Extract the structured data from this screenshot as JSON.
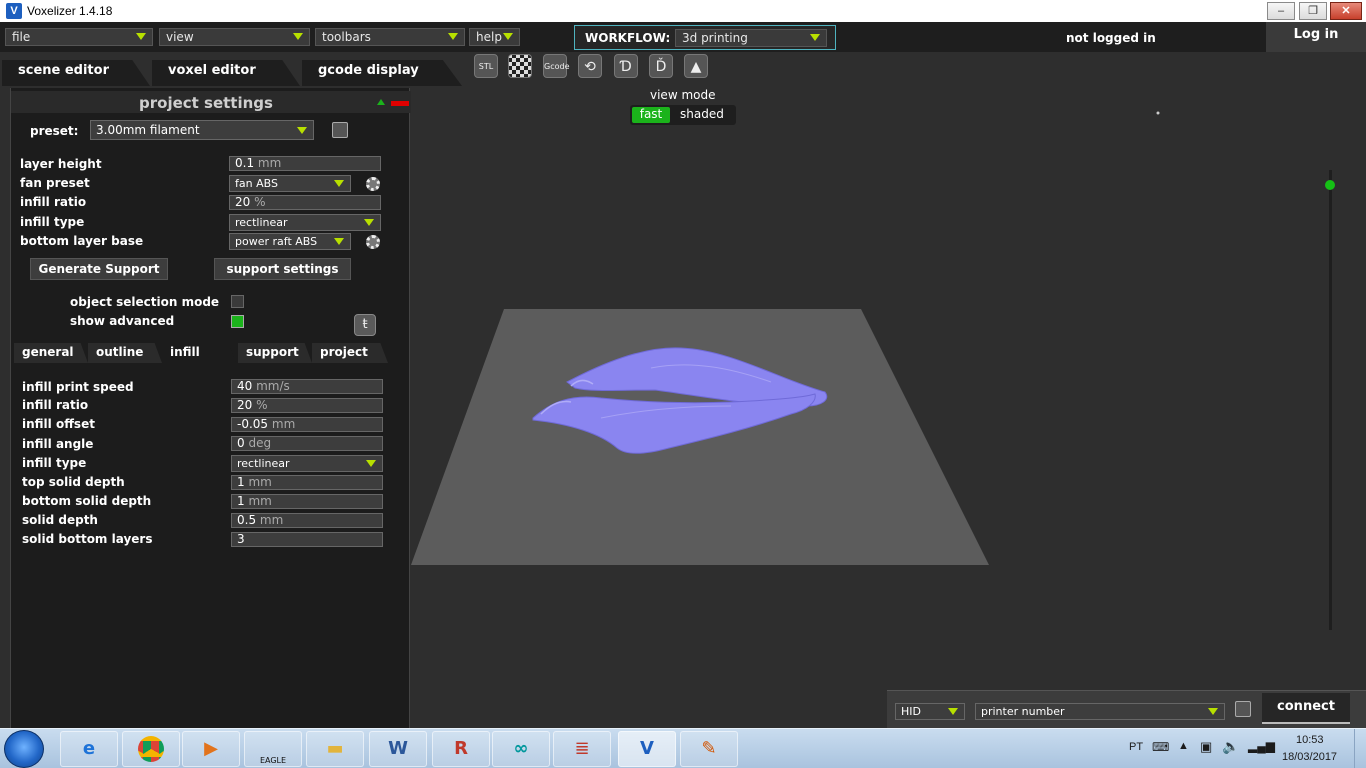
{
  "window": {
    "title": "Voxelizer 1.4.18"
  },
  "menubar": {
    "file": "file",
    "view": "view",
    "toolbars": "toolbars",
    "help": "help",
    "workflow_label": "WORKFLOW:",
    "workflow_value": "3d printing",
    "login_status": "not logged in",
    "login_button": "Log in"
  },
  "tabs": {
    "scene_editor": "scene editor",
    "voxel_editor": "voxel editor",
    "gcode_display": "gcode display"
  },
  "toolbar_icons": {
    "stl": "STL",
    "gcode": "Gcode"
  },
  "panel": {
    "title": "project settings",
    "preset_label": "preset:",
    "preset_value": "3.00mm filament",
    "layer_height_label": "layer height",
    "layer_height_value": "0.1",
    "layer_height_unit": "mm",
    "fan_preset_label": "fan preset",
    "fan_preset_value": "fan ABS",
    "infill_ratio_label": "infill ratio",
    "infill_ratio_value": "20",
    "infill_ratio_unit": "%",
    "infill_type_label": "infill type",
    "infill_type_value": "rectlinear",
    "bottom_layer_base_label": "bottom layer base",
    "bottom_layer_base_value": "power raft ABS",
    "generate_support": "Generate Support",
    "support_settings": "support settings",
    "object_selection_mode": "object selection mode",
    "show_advanced": "show advanced",
    "subtabs": {
      "general": "general",
      "outline": "outline",
      "infill": "infill",
      "support": "support",
      "project": "project"
    },
    "adv": {
      "speed_label": "infill print speed",
      "speed_value": "40",
      "speed_unit": "mm/s",
      "ratio_label": "infill ratio",
      "ratio_value": "20",
      "ratio_unit": "%",
      "offset_label": "infill offset",
      "offset_value": "-0.05",
      "offset_unit": "mm",
      "angle_label": "infill angle",
      "angle_value": "0",
      "angle_unit": "deg",
      "type_label": "infill type",
      "type_value": "rectlinear",
      "top_label": "top solid depth",
      "top_value": "1",
      "top_unit": "mm",
      "bottom_label": "bottom solid depth",
      "bottom_value": "1",
      "bottom_unit": "mm",
      "solid_label": "solid depth",
      "solid_value": "0.5",
      "solid_unit": "mm",
      "layers_label": "solid bottom layers",
      "layers_value": "3"
    }
  },
  "viewport": {
    "view_mode_label": "view mode",
    "fast": "fast",
    "shaded": "shaded"
  },
  "connection": {
    "port": "HID",
    "printer": "printer number",
    "connect": "connect"
  },
  "taskbar": {
    "lang": "PT",
    "time": "10:53",
    "date": "18/03/2017",
    "eagle": "EAGLE"
  },
  "colors": {
    "accent_green": "#1bb31b",
    "arrow_yellow": "#b8e000",
    "workflow_border": "#4fb3bf",
    "model": "#8a85f0"
  }
}
